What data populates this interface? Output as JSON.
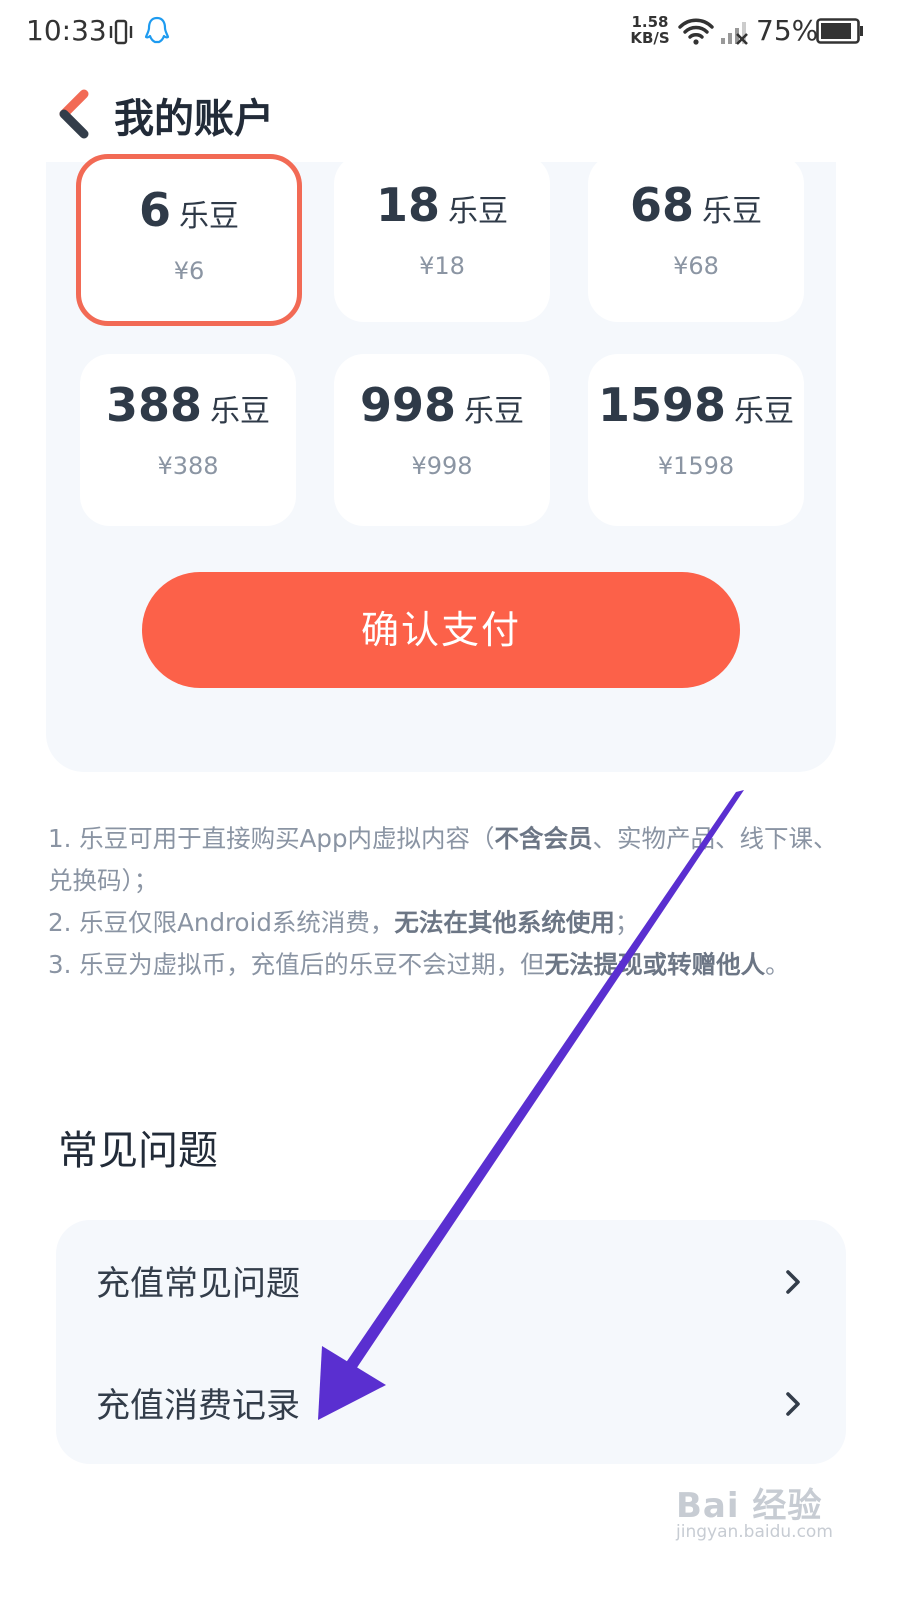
{
  "status_bar": {
    "time": "10:33",
    "net_speed_value": "1.58",
    "net_speed_unit": "KB/S",
    "battery": "75%"
  },
  "header": {
    "title": "我的账户"
  },
  "recharge": {
    "options": [
      {
        "amount": "6",
        "unit": "乐豆",
        "price": "¥6",
        "selected": true
      },
      {
        "amount": "18",
        "unit": "乐豆",
        "price": "¥18",
        "selected": false
      },
      {
        "amount": "68",
        "unit": "乐豆",
        "price": "¥68",
        "selected": false
      },
      {
        "amount": "388",
        "unit": "乐豆",
        "price": "¥388",
        "selected": false
      },
      {
        "amount": "998",
        "unit": "乐豆",
        "price": "¥998",
        "selected": false
      },
      {
        "amount": "1598",
        "unit": "乐豆",
        "price": "¥1598",
        "selected": false
      }
    ],
    "confirm_label": "确认支付"
  },
  "notes": {
    "n1_a": "1. 乐豆可用于直接购买App内虚拟内容（",
    "n1_b": "不含会员",
    "n1_c": "、实物产品、线下课、兑换码）；",
    "n2_a": "2. 乐豆仅限Android系统消费，",
    "n2_b": "无法在其他系统使用",
    "n2_c": "；",
    "n3_a": "3. 乐豆为虚拟币，充值后的乐豆不会过期，但",
    "n3_b": "无法提现或转赠他人",
    "n3_c": "。"
  },
  "faq": {
    "heading": "常见问题",
    "items": [
      {
        "label": "充值常见问题"
      },
      {
        "label": "充值消费记录"
      }
    ]
  },
  "watermark": {
    "main": "Bai 经验",
    "sub": "jingyan.baidu.com"
  },
  "colors": {
    "accent": "#fc6149",
    "selected_border": "#f26a55",
    "arrow": "#5a2fd0",
    "panel_bg": "#f5f8fc"
  }
}
